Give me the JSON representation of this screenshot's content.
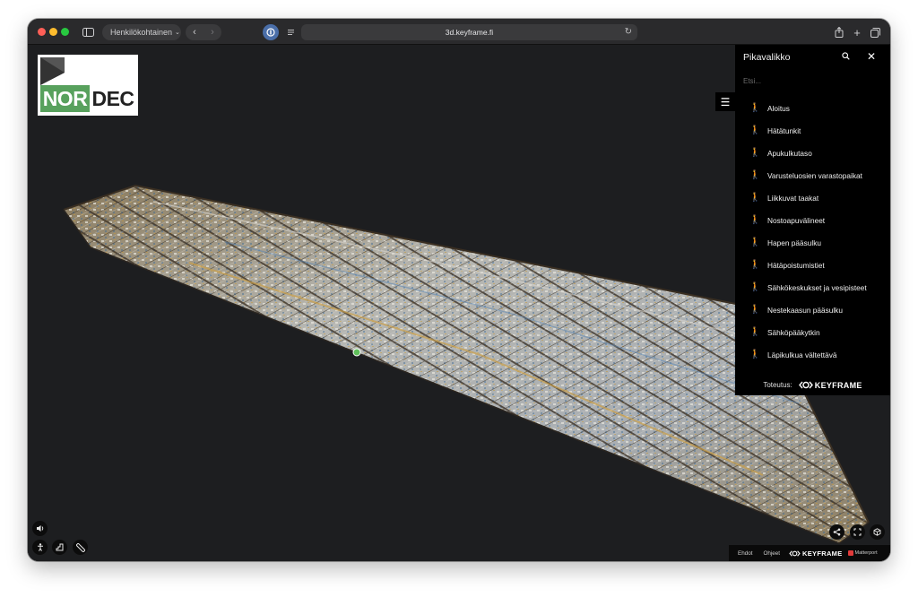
{
  "browser": {
    "profile_label": "Henkilökohtainen",
    "url": "3d.keyframe.fi"
  },
  "logo": {
    "part1": "NOR",
    "part2": "DEC",
    "accent": "#58a15d"
  },
  "panel": {
    "title": "Pikavalikko",
    "search_placeholder": "Etsi...",
    "items": [
      {
        "label": "Aloitus"
      },
      {
        "label": "Hätätunkit"
      },
      {
        "label": "Apukulkutaso"
      },
      {
        "label": "Varusteluosien varastopaikat"
      },
      {
        "label": "Liikkuvat taakat"
      },
      {
        "label": "Nostoapuvälineet"
      },
      {
        "label": "Hapen pääsulku"
      },
      {
        "label": "Hätäpoistumistiet"
      },
      {
        "label": "Sähkökeskukset ja vesipisteet"
      },
      {
        "label": "Nestekaasun pääsulku"
      },
      {
        "label": "Sähköpääkytkin"
      },
      {
        "label": "Läpikulkua vältettävä"
      }
    ],
    "footer_prefix": "Toteutus:",
    "brand": "KEYFRAME"
  },
  "bottom_bar": {
    "terms": "Ehdot",
    "help": "Ohjeet",
    "brand": "KEYFRAME",
    "powered": "Matterport"
  },
  "icons": {
    "walk": "walking-person-icon",
    "sound": "speaker-icon",
    "person": "person-icon",
    "floorplan": "floorplan-icon",
    "measure": "ruler-icon",
    "share": "share-icon",
    "fullscreen": "fullscreen-icon",
    "dollhouse": "cube-icon"
  }
}
